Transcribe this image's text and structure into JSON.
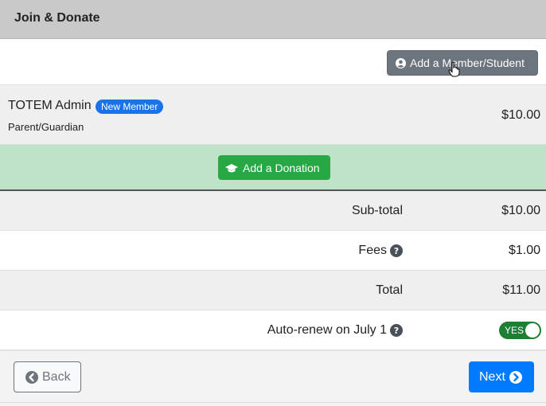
{
  "header": {
    "title": "Join & Donate"
  },
  "add_member": {
    "label": "Add a Member/Student",
    "icon": "user-circle-icon"
  },
  "members": [
    {
      "name": "TOTEM Admin",
      "badge": "New Member",
      "role": "Parent/Guardian",
      "price": "$10.00"
    }
  ],
  "donation": {
    "label": "Add a Donation",
    "icon": "graduation-cap-icon"
  },
  "summary": {
    "subtotal": {
      "label": "Sub-total",
      "value": "$10.00"
    },
    "fees": {
      "label": "Fees",
      "value": "$1.00"
    },
    "total": {
      "label": "Total",
      "value": "$11.00"
    },
    "auto_renew": {
      "label": "Auto-renew on July 1",
      "toggle": "YES",
      "enabled": true
    }
  },
  "footer": {
    "back_label": "Back",
    "next_label": "Next"
  },
  "colors": {
    "primary": "#007bff",
    "success": "#28a745",
    "secondary": "#6c757d",
    "badge": "#1a73e8"
  }
}
